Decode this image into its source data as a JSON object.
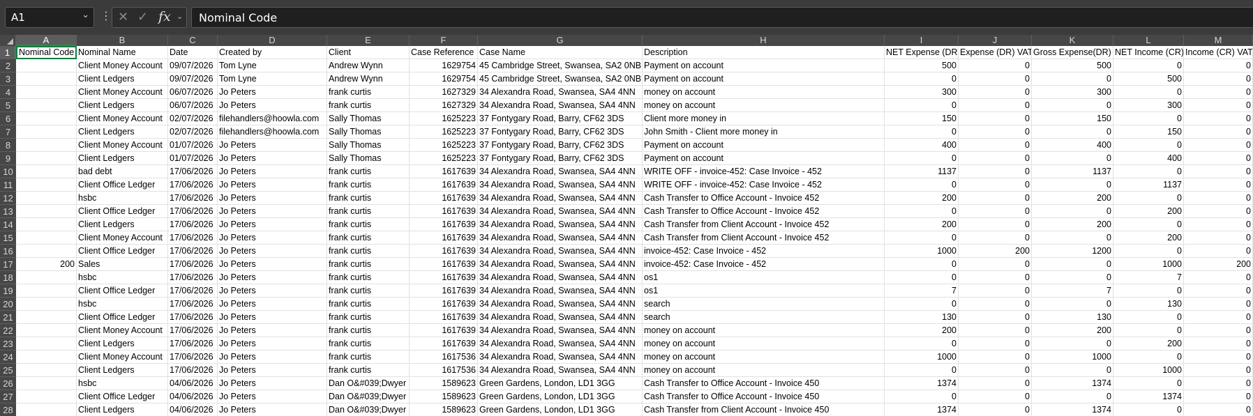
{
  "name_box": {
    "value": "A1"
  },
  "formula_bar": {
    "content": "Nominal Code",
    "fx_label": "fx",
    "cancel_glyph": "✕",
    "enter_glyph": "✓"
  },
  "column_letters": [
    "A",
    "B",
    "C",
    "D",
    "E",
    "F",
    "G",
    "H",
    "I",
    "J",
    "K",
    "L",
    "M"
  ],
  "header_row": [
    "Nominal Code",
    "Nominal Name",
    "Date",
    "Created by",
    "Client",
    "Case Reference",
    "Case Name",
    "Description",
    "NET Expense (DR)",
    "Expense (DR) VAT",
    "Gross Expense(DR)",
    "NET Income (CR)",
    "Income (CR) VAT"
  ],
  "rows": [
    {
      "n": "2",
      "c": [
        "",
        "Client Money Account",
        "09/07/2026",
        "Tom Lyne",
        "Andrew Wynn",
        "1629754",
        "45 Cambridge Street, Swansea, SA2 0NB",
        "Payment on account",
        "500",
        "0",
        "500",
        "0",
        "0"
      ]
    },
    {
      "n": "3",
      "c": [
        "",
        "Client Ledgers",
        "09/07/2026",
        "Tom Lyne",
        "Andrew Wynn",
        "1629754",
        "45 Cambridge Street, Swansea, SA2 0NB",
        "Payment on account",
        "0",
        "0",
        "0",
        "500",
        "0"
      ]
    },
    {
      "n": "4",
      "c": [
        "",
        "Client Money Account",
        "06/07/2026",
        "Jo Peters",
        "frank curtis",
        "1627329",
        "34 Alexandra Road, Swansea, SA4 4NN",
        "money on account",
        "300",
        "0",
        "300",
        "0",
        "0"
      ]
    },
    {
      "n": "5",
      "c": [
        "",
        "Client Ledgers",
        "06/07/2026",
        "Jo Peters",
        "frank curtis",
        "1627329",
        "34 Alexandra Road, Swansea, SA4 4NN",
        "money on account",
        "0",
        "0",
        "0",
        "300",
        "0"
      ]
    },
    {
      "n": "6",
      "c": [
        "",
        "Client Money Account",
        "02/07/2026",
        "filehandlers@hoowla.com",
        "Sally Thomas",
        "1625223",
        "37 Fontygary Road, Barry, CF62 3DS",
        "Client more money in",
        "150",
        "0",
        "150",
        "0",
        "0"
      ]
    },
    {
      "n": "7",
      "c": [
        "",
        "Client Ledgers",
        "02/07/2026",
        "filehandlers@hoowla.com",
        "Sally Thomas",
        "1625223",
        "37 Fontygary Road, Barry, CF62 3DS",
        "John Smith - Client more money in",
        "0",
        "0",
        "0",
        "150",
        "0"
      ]
    },
    {
      "n": "8",
      "c": [
        "",
        "Client Money Account",
        "01/07/2026",
        "Jo Peters",
        "Sally Thomas",
        "1625223",
        "37 Fontygary Road, Barry, CF62 3DS",
        "Payment on account",
        "400",
        "0",
        "400",
        "0",
        "0"
      ]
    },
    {
      "n": "9",
      "c": [
        "",
        "Client Ledgers",
        "01/07/2026",
        "Jo Peters",
        "Sally Thomas",
        "1625223",
        "37 Fontygary Road, Barry, CF62 3DS",
        "Payment on account",
        "0",
        "0",
        "0",
        "400",
        "0"
      ]
    },
    {
      "n": "10",
      "c": [
        "",
        "bad debt",
        "17/06/2026",
        "Jo Peters",
        "frank curtis",
        "1617639",
        "34 Alexandra Road, Swansea, SA4 4NN",
        "WRITE OFF - invoice-452: Case Invoice - 452",
        "1137",
        "0",
        "1137",
        "0",
        "0"
      ]
    },
    {
      "n": "11",
      "c": [
        "",
        "Client Office Ledger",
        "17/06/2026",
        "Jo Peters",
        "frank curtis",
        "1617639",
        "34 Alexandra Road, Swansea, SA4 4NN",
        "WRITE OFF - invoice-452: Case Invoice - 452",
        "0",
        "0",
        "0",
        "1137",
        "0"
      ]
    },
    {
      "n": "12",
      "c": [
        "",
        "hsbc",
        "17/06/2026",
        "Jo Peters",
        "frank curtis",
        "1617639",
        "34 Alexandra Road, Swansea, SA4 4NN",
        "Cash Transfer to Office Account - Invoice 452",
        "200",
        "0",
        "200",
        "0",
        "0"
      ]
    },
    {
      "n": "13",
      "c": [
        "",
        "Client Office Ledger",
        "17/06/2026",
        "Jo Peters",
        "frank curtis",
        "1617639",
        "34 Alexandra Road, Swansea, SA4 4NN",
        "Cash Transfer to Office Account - Invoice 452",
        "0",
        "0",
        "0",
        "200",
        "0"
      ]
    },
    {
      "n": "14",
      "c": [
        "",
        "Client Ledgers",
        "17/06/2026",
        "Jo Peters",
        "frank curtis",
        "1617639",
        "34 Alexandra Road, Swansea, SA4 4NN",
        "Cash Transfer from Client Account - Invoice 452",
        "200",
        "0",
        "200",
        "0",
        "0"
      ]
    },
    {
      "n": "15",
      "c": [
        "",
        "Client Money Account",
        "17/06/2026",
        "Jo Peters",
        "frank curtis",
        "1617639",
        "34 Alexandra Road, Swansea, SA4 4NN",
        "Cash Transfer from Client Account - Invoice 452",
        "0",
        "0",
        "0",
        "200",
        "0"
      ]
    },
    {
      "n": "16",
      "c": [
        "",
        "Client Office Ledger",
        "17/06/2026",
        "Jo Peters",
        "frank curtis",
        "1617639",
        "34 Alexandra Road, Swansea, SA4 4NN",
        "invoice-452: Case Invoice - 452",
        "1000",
        "200",
        "1200",
        "0",
        "0"
      ]
    },
    {
      "n": "17",
      "c": [
        "200",
        "Sales",
        "17/06/2026",
        "Jo Peters",
        "frank curtis",
        "1617639",
        "34 Alexandra Road, Swansea, SA4 4NN",
        "invoice-452: Case Invoice - 452",
        "0",
        "0",
        "0",
        "1000",
        "200"
      ]
    },
    {
      "n": "18",
      "c": [
        "",
        "hsbc",
        "17/06/2026",
        "Jo Peters",
        "frank curtis",
        "1617639",
        "34 Alexandra Road, Swansea, SA4 4NN",
        "os1",
        "0",
        "0",
        "0",
        "7",
        "0"
      ]
    },
    {
      "n": "19",
      "c": [
        "",
        "Client Office Ledger",
        "17/06/2026",
        "Jo Peters",
        "frank curtis",
        "1617639",
        "34 Alexandra Road, Swansea, SA4 4NN",
        "os1",
        "7",
        "0",
        "7",
        "0",
        "0"
      ]
    },
    {
      "n": "20",
      "c": [
        "",
        "hsbc",
        "17/06/2026",
        "Jo Peters",
        "frank curtis",
        "1617639",
        "34 Alexandra Road, Swansea, SA4 4NN",
        "search",
        "0",
        "0",
        "0",
        "130",
        "0"
      ]
    },
    {
      "n": "21",
      "c": [
        "",
        "Client Office Ledger",
        "17/06/2026",
        "Jo Peters",
        "frank curtis",
        "1617639",
        "34 Alexandra Road, Swansea, SA4 4NN",
        "search",
        "130",
        "0",
        "130",
        "0",
        "0"
      ]
    },
    {
      "n": "22",
      "c": [
        "",
        "Client Money Account",
        "17/06/2026",
        "Jo Peters",
        "frank curtis",
        "1617639",
        "34 Alexandra Road, Swansea, SA4 4NN",
        "money on account",
        "200",
        "0",
        "200",
        "0",
        "0"
      ]
    },
    {
      "n": "23",
      "c": [
        "",
        "Client Ledgers",
        "17/06/2026",
        "Jo Peters",
        "frank curtis",
        "1617639",
        "34 Alexandra Road, Swansea, SA4 4NN",
        "money on account",
        "0",
        "0",
        "0",
        "200",
        "0"
      ]
    },
    {
      "n": "24",
      "c": [
        "",
        "Client Money Account",
        "17/06/2026",
        "Jo Peters",
        "frank curtis",
        "1617536",
        "34 Alexandra Road, Swansea, SA4 4NN",
        "money on account",
        "1000",
        "0",
        "1000",
        "0",
        "0"
      ]
    },
    {
      "n": "25",
      "c": [
        "",
        "Client Ledgers",
        "17/06/2026",
        "Jo Peters",
        "frank curtis",
        "1617536",
        "34 Alexandra Road, Swansea, SA4 4NN",
        "money on account",
        "0",
        "0",
        "0",
        "1000",
        "0"
      ]
    },
    {
      "n": "26",
      "c": [
        "",
        "hsbc",
        "04/06/2026",
        "Jo Peters",
        "Dan O&#039;Dwyer",
        "1589623",
        "Green Gardens, London, LD1 3GG",
        "Cash Transfer to Office Account - Invoice 450",
        "1374",
        "0",
        "1374",
        "0",
        "0"
      ]
    },
    {
      "n": "27",
      "c": [
        "",
        "Client Office Ledger",
        "04/06/2026",
        "Jo Peters",
        "Dan O&#039;Dwyer",
        "1589623",
        "Green Gardens, London, LD1 3GG",
        "Cash Transfer to Office Account - Invoice 450",
        "0",
        "0",
        "0",
        "1374",
        "0"
      ]
    },
    {
      "n": "28",
      "c": [
        "",
        "Client Ledgers",
        "04/06/2026",
        "Jo Peters",
        "Dan O&#039;Dwyer",
        "1589623",
        "Green Gardens, London, LD1 3GG",
        "Cash Transfer from Client Account - Invoice 450",
        "1374",
        "0",
        "1374",
        "0",
        "0"
      ]
    }
  ]
}
